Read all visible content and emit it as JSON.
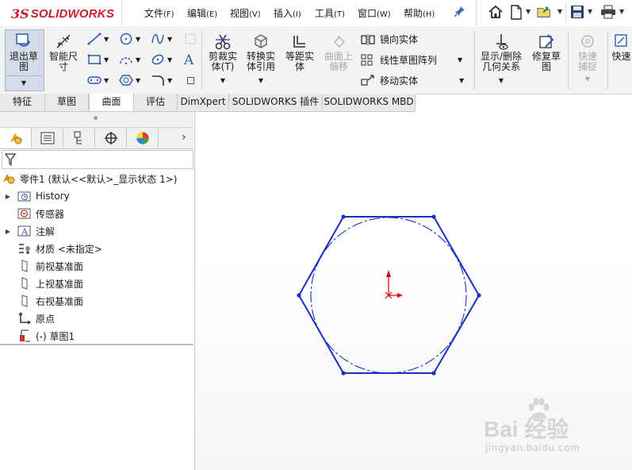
{
  "app": {
    "logo_ds": "3S",
    "logo_name": "SOLIDWORKS"
  },
  "menu": [
    {
      "label": "文件",
      "accel": "(F)"
    },
    {
      "label": "编辑",
      "accel": "(E)"
    },
    {
      "label": "视图",
      "accel": "(V)"
    },
    {
      "label": "插入",
      "accel": "(I)"
    },
    {
      "label": "工具",
      "accel": "(T)"
    },
    {
      "label": "窗口",
      "accel": "(W)"
    },
    {
      "label": "帮助",
      "accel": "(H)"
    }
  ],
  "quick_access": [
    "home-icon",
    "new-document-icon",
    "open-folder-icon",
    "save-icon",
    "print-icon"
  ],
  "commands": {
    "exit_sketch": "退出草图",
    "smart_dimension": "智能尺寸",
    "trim_entities": "剪裁实体(T)",
    "convert_entities": "转换实体引用",
    "offset_entities": "等距实体",
    "offset_on_surface": "曲面上偏移",
    "mirror_entities": "镜向实体",
    "linear_pattern": "线性草图阵列",
    "move_entities": "移动实体",
    "display_delete_relations": "显示/删除几何关系",
    "repair_sketch": "修复草图",
    "quick_snaps": "快速捕捉",
    "rapid_sketch": "快速"
  },
  "tabs": [
    "特征",
    "草图",
    "曲面",
    "评估",
    "DimXpert",
    "SOLIDWORKS 插件",
    "SOLIDWORKS MBD"
  ],
  "active_tab_index": 2,
  "feature_tree": {
    "root": "零件1 (默认<<默认>_显示状态 1>)",
    "items": [
      {
        "label": "History",
        "icon": "history-folder-icon",
        "expandable": true
      },
      {
        "label": "传感器",
        "icon": "sensor-icon",
        "expandable": false
      },
      {
        "label": "注解",
        "icon": "annotations-icon",
        "expandable": true
      },
      {
        "label": "材质 <未指定>",
        "icon": "material-icon",
        "expandable": false
      },
      {
        "label": "前视基准面",
        "icon": "plane-icon",
        "expandable": false
      },
      {
        "label": "上视基准面",
        "icon": "plane-icon",
        "expandable": false
      },
      {
        "label": "右视基准面",
        "icon": "plane-icon",
        "expandable": false
      },
      {
        "label": "原点",
        "icon": "origin-icon",
        "expandable": false
      },
      {
        "label": "(-) 草图1",
        "icon": "sketch-icon",
        "expandable": false
      }
    ]
  },
  "colors": {
    "sketch_line": "#1a2fc0",
    "origin": "#d40000",
    "logo": "#c8202c"
  },
  "watermark": {
    "brand": "Bai 经验",
    "url": "jingyan.baidu.com"
  }
}
